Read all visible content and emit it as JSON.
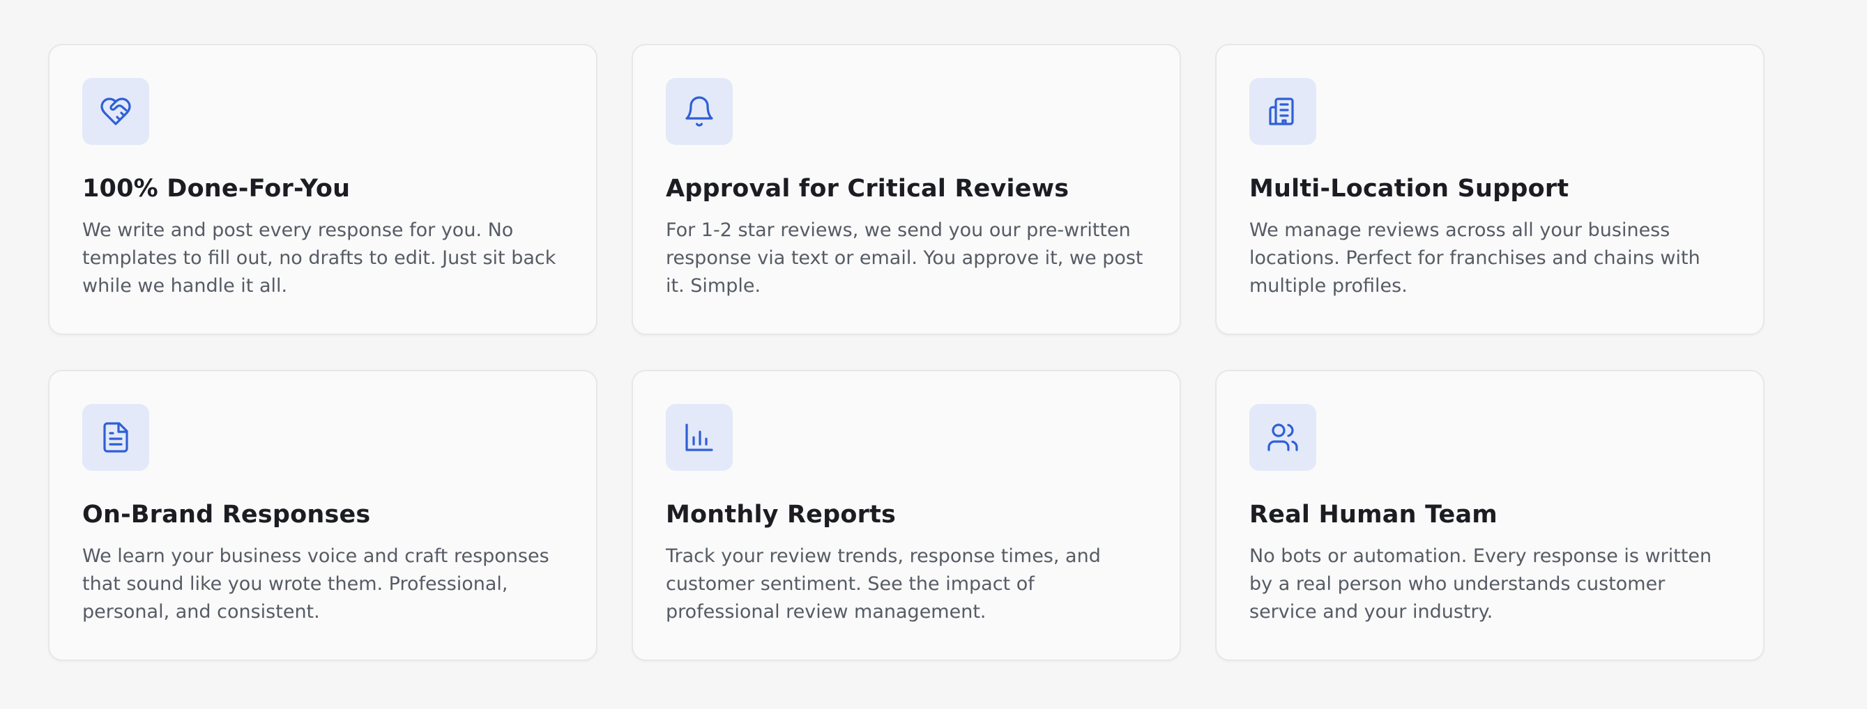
{
  "features": [
    {
      "icon": "heart-handshake-icon",
      "title": "100% Done-For-You",
      "description": "We write and post every response for you. No templates to fill out, no drafts to edit. Just sit back while we handle it all."
    },
    {
      "icon": "bell-icon",
      "title": "Approval for Critical Reviews",
      "description": "For 1-2 star reviews, we send you our pre-written response via text or email. You approve it, we post it. Simple."
    },
    {
      "icon": "building-icon",
      "title": "Multi-Location Support",
      "description": "We manage reviews across all your business locations. Perfect for franchises and chains with multiple profiles."
    },
    {
      "icon": "document-icon",
      "title": "On-Brand Responses",
      "description": "We learn your business voice and craft responses that sound like you wrote them. Professional, personal, and consistent."
    },
    {
      "icon": "bar-chart-icon",
      "title": "Monthly Reports",
      "description": "Track your review trends, response times, and customer sentiment. See the impact of professional review management."
    },
    {
      "icon": "users-icon",
      "title": "Real Human Team",
      "description": "No bots or automation. Every response is written by a real person who understands customer service and your industry."
    }
  ],
  "colors": {
    "accent": "#2f5fd6",
    "icon_bg": "#e3e9f8",
    "card_bg": "#fafafa",
    "page_bg": "#f6f6f6"
  }
}
